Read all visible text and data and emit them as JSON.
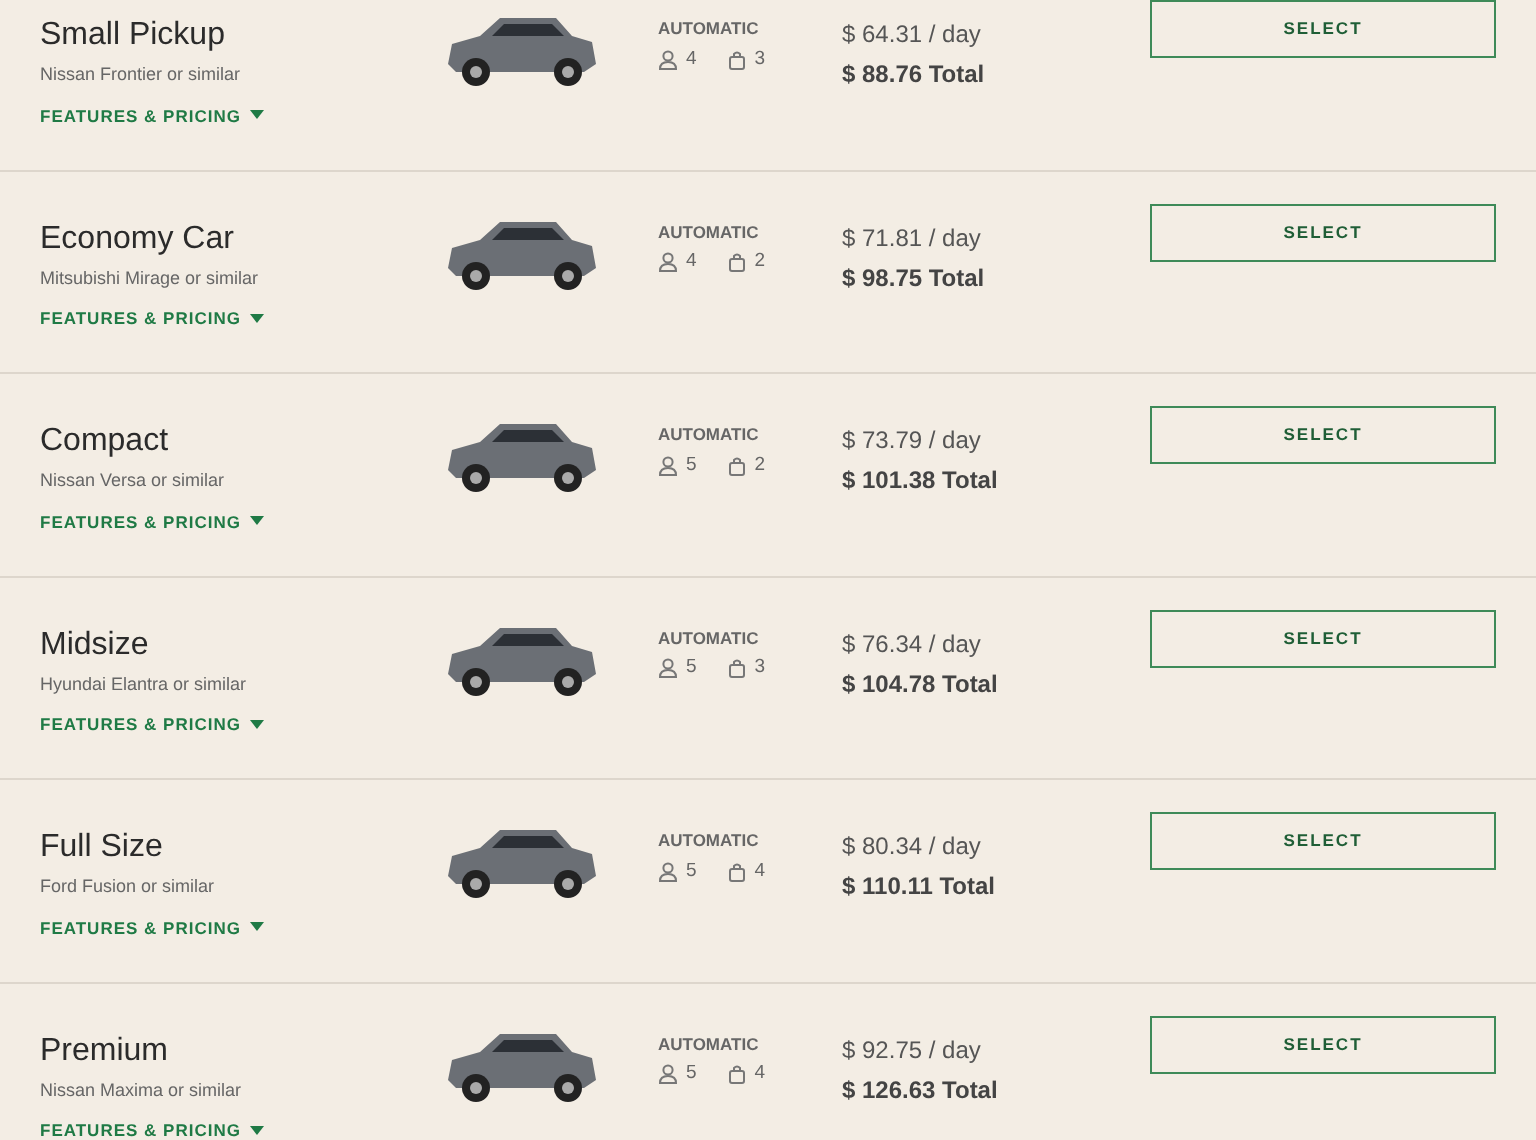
{
  "vehicles": [
    {
      "name": "Small Pickup",
      "model": "Nissan Frontier or similar",
      "link": "FEATURES & PRICING",
      "transmission": "AUTOMATIC",
      "passengers": "4",
      "bags": "3",
      "per_day": "$ 64.31 / day",
      "total": "$ 88.76 Total",
      "button": "SELECT"
    },
    {
      "name": "Economy Car",
      "model": "Mitsubishi Mirage or similar",
      "link": "FEATURES & PRICING",
      "transmission": "AUTOMATIC",
      "passengers": "4",
      "bags": "2",
      "per_day": "$ 71.81 / day",
      "total": "$ 98.75 Total",
      "button": "SELECT"
    },
    {
      "name": "Compact",
      "model": "Nissan Versa or similar",
      "link": "FEATURES & PRICING",
      "transmission": "AUTOMATIC",
      "passengers": "5",
      "bags": "2",
      "per_day": "$ 73.79 / day",
      "total": "$ 101.38 Total",
      "button": "SELECT"
    },
    {
      "name": "Midsize",
      "model": "Hyundai Elantra or similar",
      "link": "FEATURES & PRICING",
      "transmission": "AUTOMATIC",
      "passengers": "5",
      "bags": "3",
      "per_day": "$ 76.34 / day",
      "total": "$ 104.78 Total",
      "button": "SELECT"
    },
    {
      "name": "Full Size",
      "model": "Ford Fusion or similar",
      "link": "FEATURES & PRICING",
      "transmission": "AUTOMATIC",
      "passengers": "5",
      "bags": "4",
      "per_day": "$ 80.34 / day",
      "total": "$ 110.11 Total",
      "button": "SELECT"
    },
    {
      "name": "Premium",
      "model": "Nissan Maxima or similar",
      "link": "FEATURES & PRICING",
      "transmission": "AUTOMATIC",
      "passengers": "5",
      "bags": "4",
      "per_day": "$ 92.75 / day",
      "total": "$ 126.63 Total",
      "button": "SELECT"
    }
  ]
}
